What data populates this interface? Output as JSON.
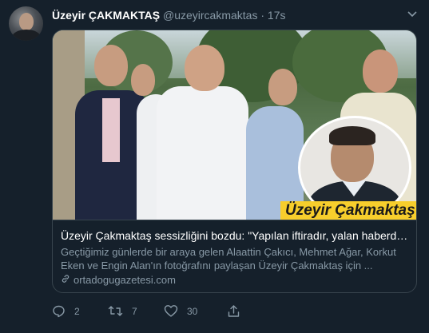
{
  "tweet": {
    "author_name": "Üzeyir ÇAKMAKTAŞ",
    "handle": "@uzeyircakmaktas",
    "separator": "·",
    "time": "17s",
    "menu_icon": "chevron-down-icon",
    "card": {
      "watermark": "Üzeyir Çakmaktaş",
      "title": "Üzeyir Çakmaktaş sessizliğini bozdu: \"Yapılan iftiradır, yalan haberdir, iti...",
      "description": "Geçtiğimiz günlerde bir araya gelen Alaattin Çakıcı, Mehmet Ağar, Korkut Eken ve Engin Alan'ın fotoğrafını paylaşan Üzeyir Çakmaktaş için ...",
      "link_icon": "link-icon",
      "domain": "ortadogugazetesi.com"
    },
    "actions": {
      "reply_icon": "reply-icon",
      "reply_count": "2",
      "retweet_icon": "retweet-icon",
      "retweet_count": "7",
      "like_icon": "heart-icon",
      "like_count": "30",
      "share_icon": "share-icon"
    }
  },
  "colors": {
    "background": "#15202b",
    "secondary_text": "#8899a6",
    "border": "#38444d",
    "watermark_bg": "#f7ce2c"
  }
}
